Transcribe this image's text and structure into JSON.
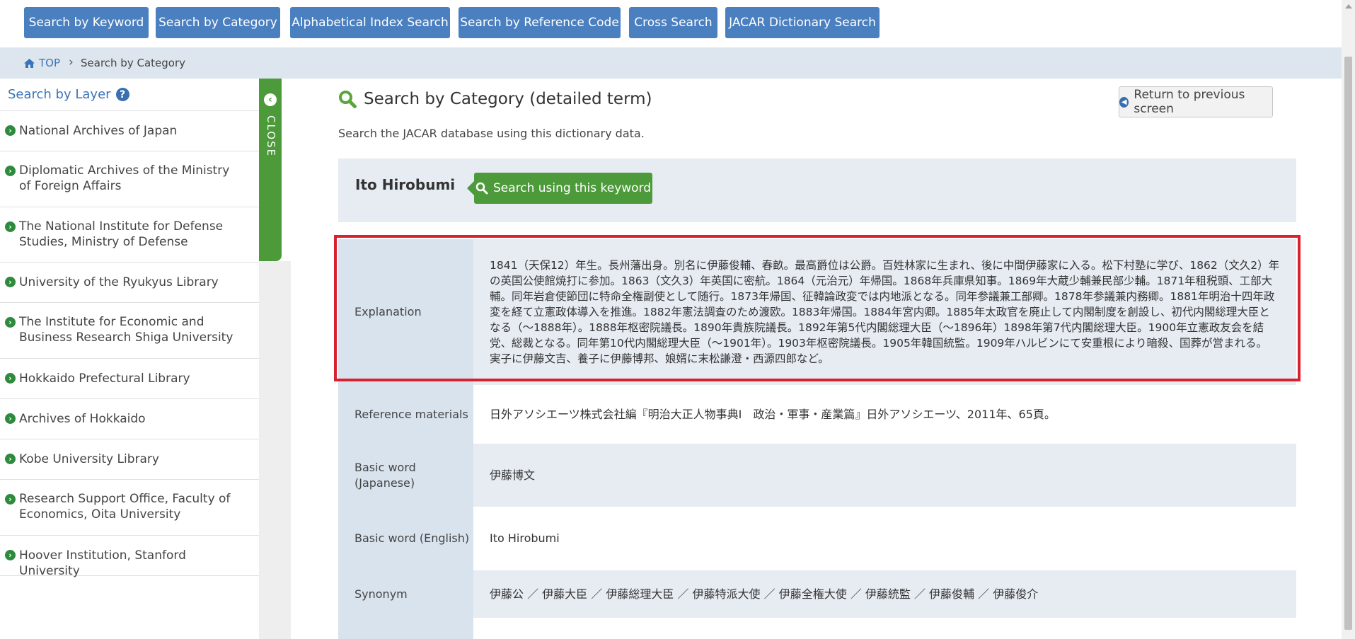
{
  "nav": {
    "buttons": [
      "Search by Keyword",
      "Search by Category",
      "Alphabetical Index Search",
      "Search by Reference Code",
      "Cross Search",
      "JACAR Dictionary Search"
    ]
  },
  "breadcrumb": {
    "home": "TOP",
    "separator": "›",
    "current": "Search by Category"
  },
  "sidebar": {
    "heading": "Search by Layer",
    "help_glyph": "?",
    "close_label": "CLOSE",
    "items": [
      "National Archives of Japan",
      "Diplomatic Archives of the Ministry of Foreign Affairs",
      "The National Institute for Defense Studies, Ministry of Defense",
      "University of the Ryukyus Library",
      "The Institute for Economic and Business Research Shiga University",
      "Hokkaido Prefectural Library",
      "Archives of Hokkaido",
      "Kobe University Library",
      "Research Support Office, Faculty of Economics, Oita University",
      "Hoover Institution, Stanford University"
    ]
  },
  "main": {
    "title": "Search by Category (detailed term)",
    "subtitle": "Search the JACAR database using this dictionary data.",
    "return_button": "Return to previous screen",
    "term": "Ito Hirobumi",
    "keyword_button": "Search using this keyword",
    "rows": [
      {
        "label": "Explanation",
        "value": "1841（天保12）年生。長州藩出身。別名に伊藤俊輔、春畝。最高爵位は公爵。百姓林家に生まれ、後に中間伊藤家に入る。松下村塾に学び、1862（文久2）年の英国公使館焼打に参加。1863（文久3）年英国に密航。1864（元治元）年帰国。1868年兵庫県知事。1869年大蔵少輔兼民部少輔。1871年租税頭、工部大輔。同年岩倉使節団に特命全権副使として随行。1873年帰国、征韓論政変では内地派となる。同年参議兼工部卿。1878年参議兼内務卿。1881年明治十四年政変を経て立憲政体導入を推進。1882年憲法調査のため渡欧。1883年帰国。1884年宮内卿。1885年太政官を廃止して内閣制度を創設し、初代内閣総理大臣となる（～1888年）。1888年枢密院議長。1890年貴族院議長。1892年第5代内閣総理大臣（～1896年）1898年第7代内閣総理大臣。1900年立憲政友会を結党、総裁となる。同年第10代内閣総理大臣（～1901年）。1903年枢密院議長。1905年韓国統監。1909年ハルビンにて安重根により暗殺、国葬が営まれる。 実子に伊藤文吉、養子に伊藤博邦、娘婿に末松謙澄・西源四郎など。"
      },
      {
        "label": "Reference materials",
        "value": "日外アソシエーツ株式会社編『明治大正人物事典Ⅰ　政治・軍事・産業篇』日外アソシエーツ、2011年、65頁。"
      },
      {
        "label": "Basic word (Japanese)",
        "value": "伊藤博文"
      },
      {
        "label": "Basic word (English)",
        "value": "Ito Hirobumi"
      },
      {
        "label": "Synonym",
        "value": "伊藤公 ／ 伊藤大臣 ／ 伊藤総理大臣 ／ 伊藤特派大使 ／ 伊藤全権大使 ／ 伊藤統監 ／ 伊藤俊輔 ／ 伊藤俊介"
      }
    ]
  },
  "colors": {
    "nav_blue": "#4a7fc0",
    "accent_green": "#4c9a3a",
    "highlight_red": "#d8222f",
    "link_blue": "#3a73b9"
  }
}
